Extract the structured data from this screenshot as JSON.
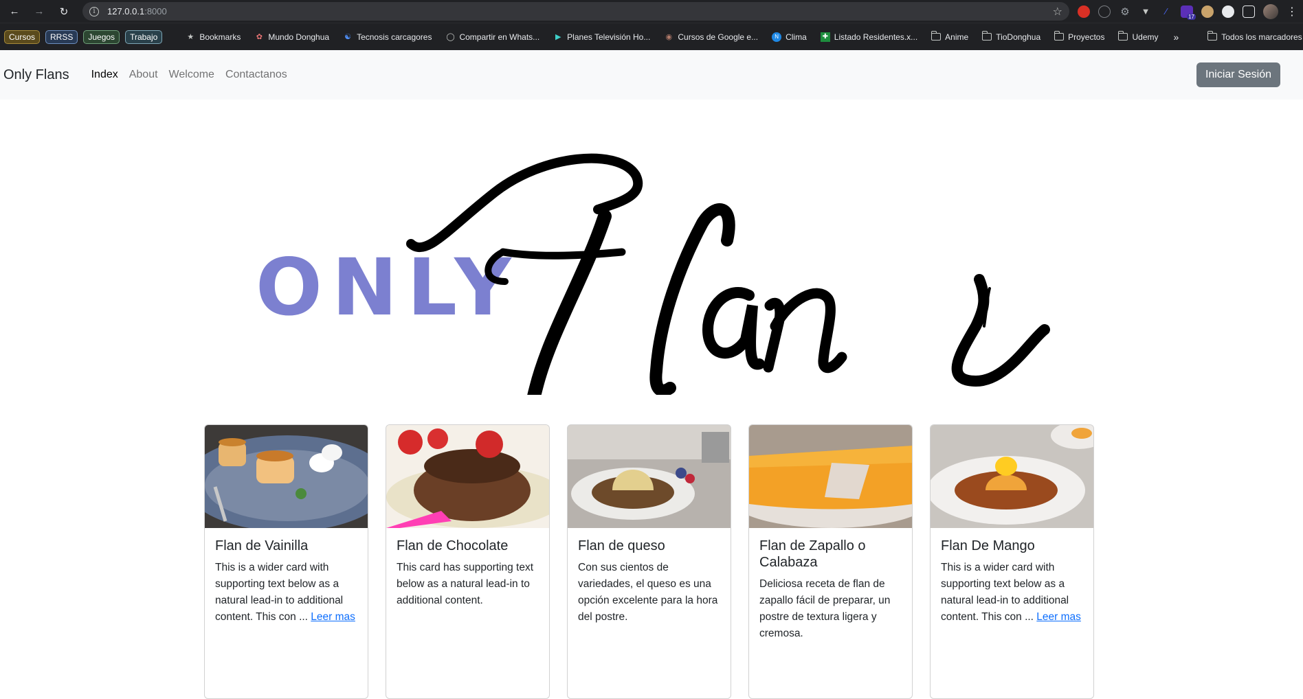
{
  "browser": {
    "url_host": "127.0.0.1",
    "url_port": ":8000",
    "bookmark_groups": [
      "Cursos",
      "RRSS",
      "Juegos",
      "Trabajo"
    ],
    "bookmarks": [
      {
        "label": "Bookmarks",
        "icon": "star-icon"
      },
      {
        "label": "Mundo Donghua",
        "icon": "site-icon"
      },
      {
        "label": "Tecnosis carcagores",
        "icon": "site-icon"
      },
      {
        "label": "Compartir en Whats...",
        "icon": "globe-icon"
      },
      {
        "label": "Planes Televisión Ho...",
        "icon": "play-icon"
      },
      {
        "label": "Cursos de Google e...",
        "icon": "site-icon"
      },
      {
        "label": "Clima",
        "icon": "weather-icon"
      },
      {
        "label": "Listado Residentes.x...",
        "icon": "sheets-icon"
      },
      {
        "label": "Anime",
        "icon": "folder-icon"
      },
      {
        "label": "TioDonghua",
        "icon": "folder-icon"
      },
      {
        "label": "Proyectos",
        "icon": "folder-icon"
      },
      {
        "label": "Udemy",
        "icon": "folder-icon"
      }
    ],
    "all_bookmarks": "Todos los marcadores",
    "extension_badge": "17"
  },
  "navbar": {
    "brand": "Only Flans",
    "links": [
      "Index",
      "About",
      "Welcome",
      "Contactanos"
    ],
    "login": "Iniciar Sesión"
  },
  "hero": {
    "only": "ONLY",
    "flans": "Flans",
    "only_color": "#7c80d0"
  },
  "cards": [
    {
      "title": "Flan de Vainilla",
      "text": "This is a wider card with supporting text below as a natural lead-in to additional content. This con ...",
      "link": "Leer mas"
    },
    {
      "title": "Flan de Chocolate",
      "text": "This card has supporting text below as a natural lead-in to additional content.",
      "link": ""
    },
    {
      "title": "Flan de queso",
      "text": "Con sus cientos de variedades, el queso es una opción excelente para la hora del postre.",
      "link": ""
    },
    {
      "title": "Flan de Zapallo o Calabaza",
      "text": "Deliciosa receta de flan de zapallo fácil de preparar, un postre de textura ligera y cremosa.",
      "link": ""
    },
    {
      "title": "Flan De Mango",
      "text": "This is a wider card with supporting text below as a natural lead-in to additional content. This con ...",
      "link": "Leer mas"
    }
  ]
}
